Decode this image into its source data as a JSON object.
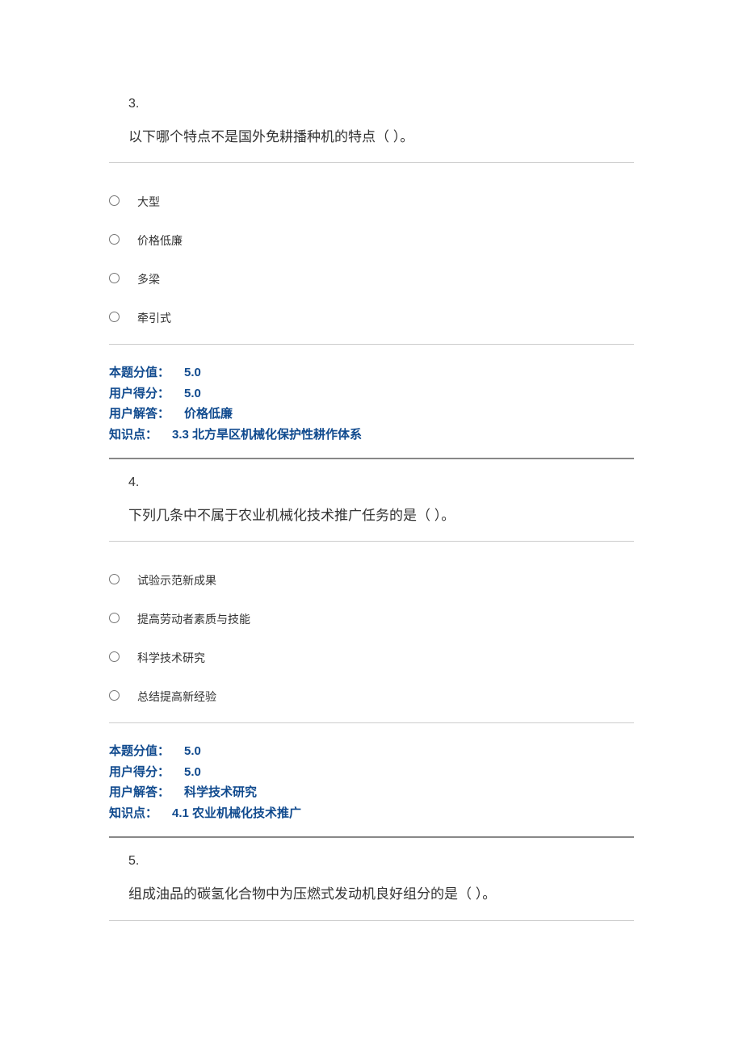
{
  "questions": [
    {
      "number": "3.",
      "text": "以下哪个特点不是国外免耕播种机的特点（ ）。",
      "options": [
        "大型",
        "价格低廉",
        "多梁",
        "牵引式"
      ],
      "meta": {
        "score_label": "本题分值：",
        "score_value": "5.0",
        "user_score_label": "用户得分：",
        "user_score_value": "5.0",
        "user_answer_label": "用户解答：",
        "user_answer_value": "价格低廉",
        "kp_label": "知识点：",
        "kp_value": "3.3  北方旱区机械化保护性耕作体系"
      }
    },
    {
      "number": "4.",
      "text": "下列几条中不属于农业机械化技术推广任务的是（ ）。",
      "options": [
        "试验示范新成果",
        "提高劳动者素质与技能",
        "科学技术研究",
        "总结提高新经验"
      ],
      "meta": {
        "score_label": "本题分值：",
        "score_value": "5.0",
        "user_score_label": "用户得分：",
        "user_score_value": "5.0",
        "user_answer_label": "用户解答：",
        "user_answer_value": "科学技术研究",
        "kp_label": "知识点：",
        "kp_value": "4.1  农业机械化技术推广"
      }
    },
    {
      "number": "5.",
      "text": "组成油品的碳氢化合物中为压燃式发动机良好组分的是（ ）。"
    }
  ]
}
